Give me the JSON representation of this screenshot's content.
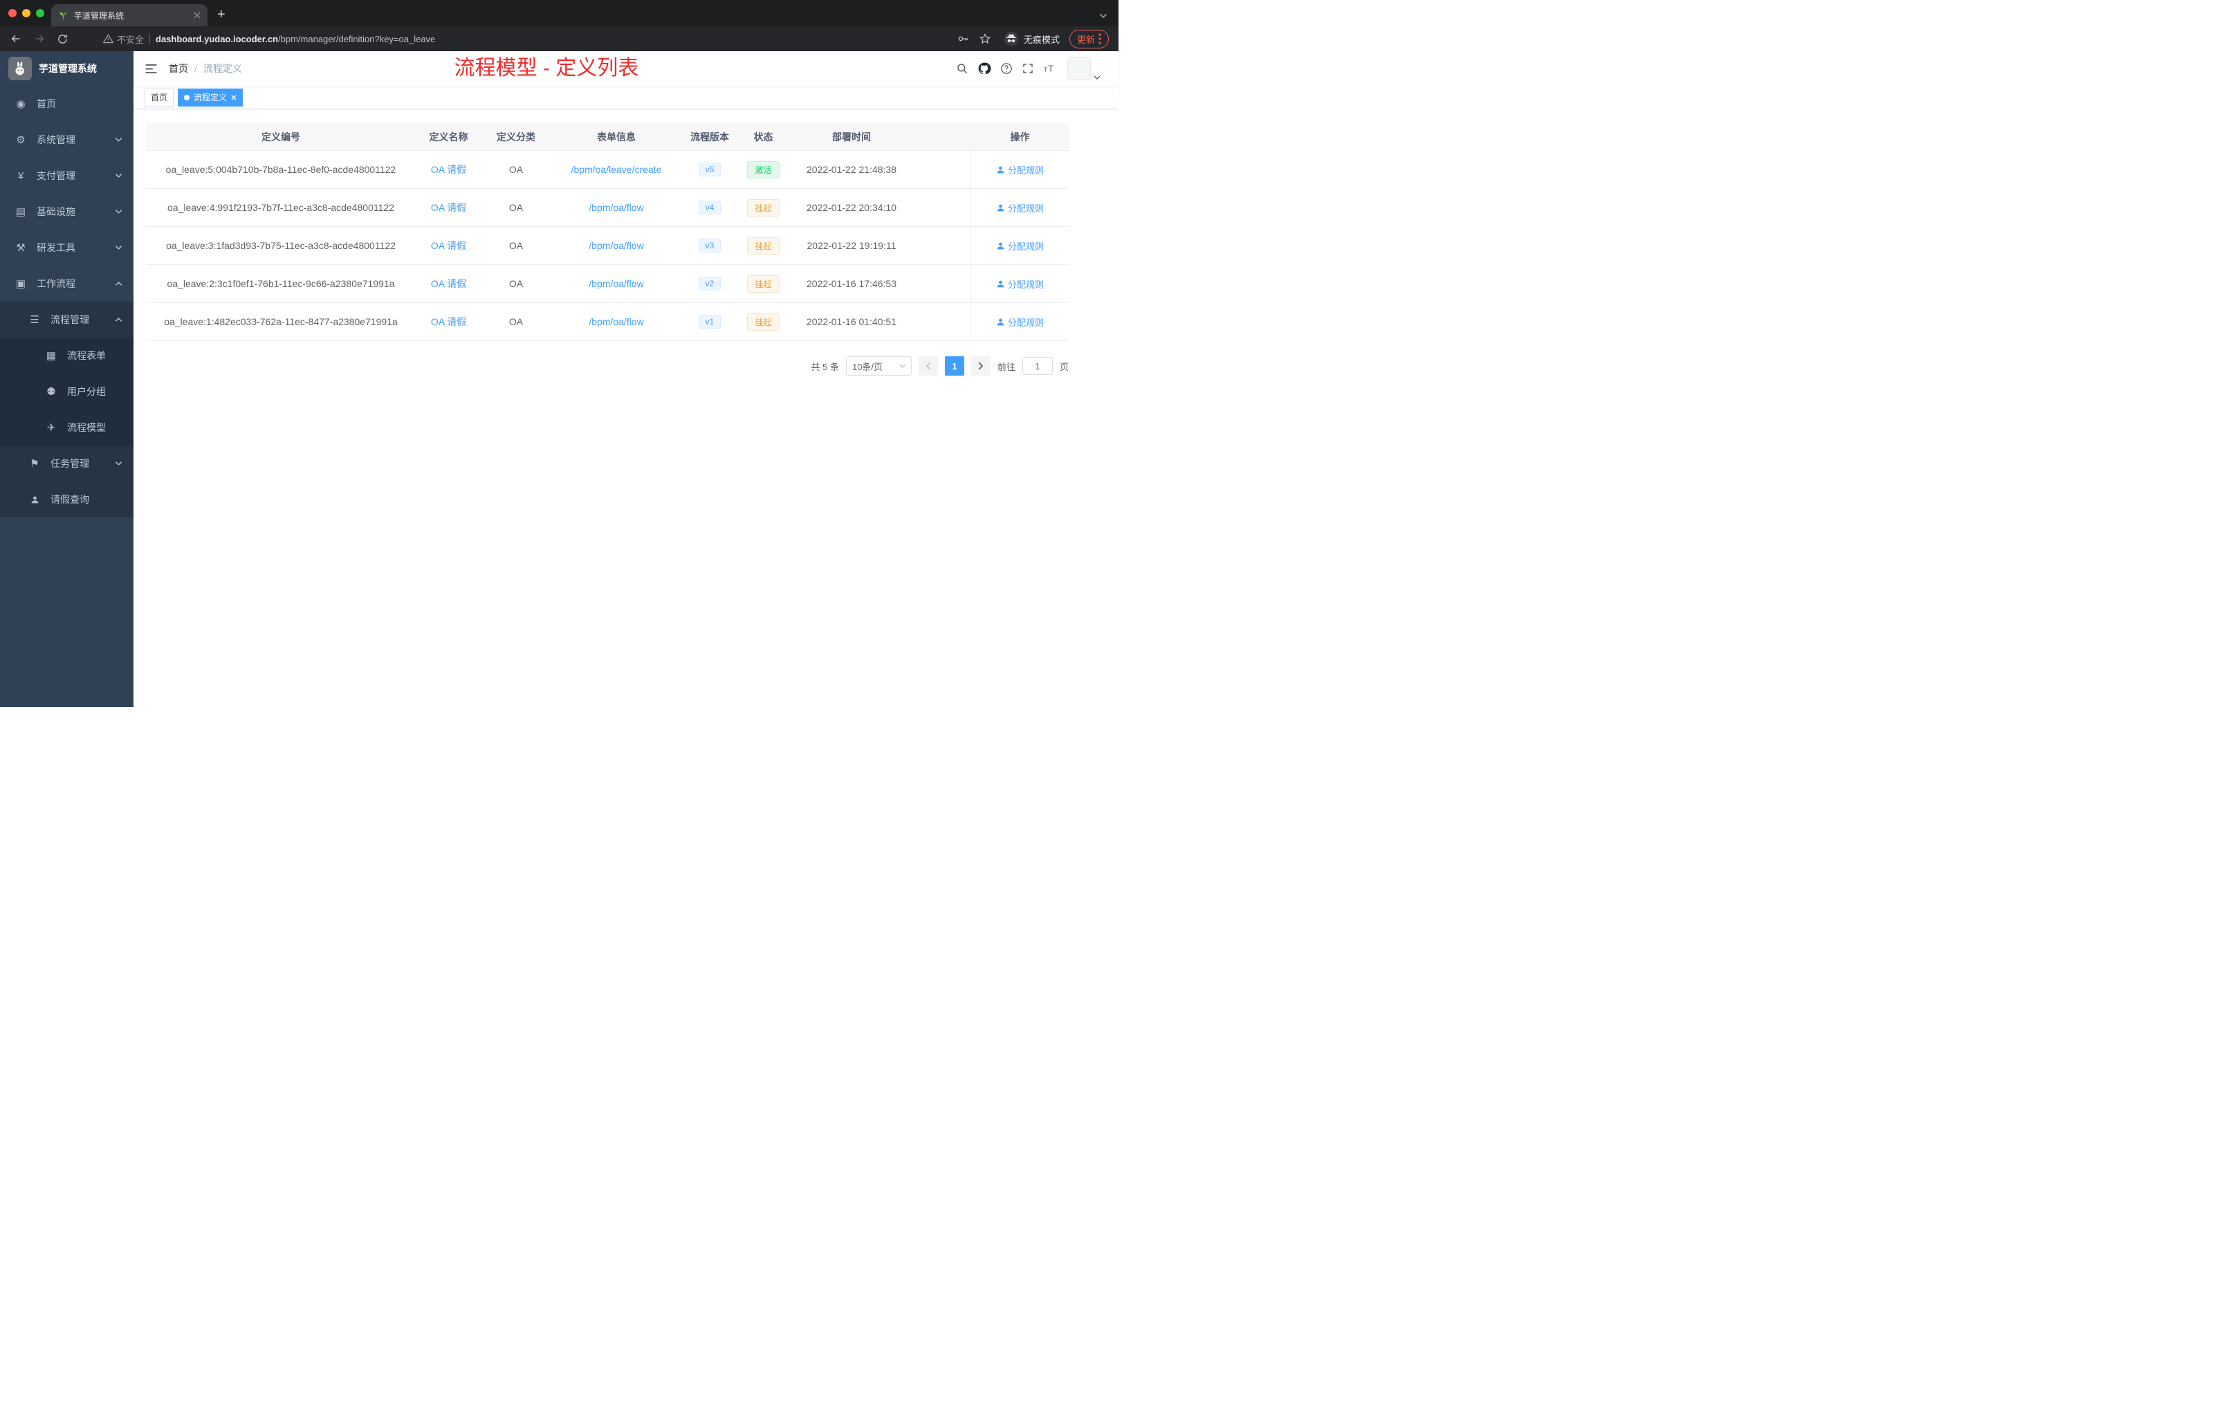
{
  "theme": {
    "accent": "#409eff",
    "annotation_red": "#f42a2a",
    "success": "#13ce66",
    "warning": "#e6a23c",
    "sidebar_bg": "#304156"
  },
  "browser": {
    "tab_title": "芋道管理系统",
    "security_label": "不安全",
    "url_domain": "dashboard.yudao.iocoder.cn",
    "url_path": "/bpm/manager/definition?key=oa_leave",
    "incognito_label": "无痕模式",
    "update_label": "更新"
  },
  "sidebar": {
    "logo_title": "芋道管理系统",
    "items": [
      {
        "label": "首页",
        "icon": "dashboard-icon",
        "level": 1
      },
      {
        "label": "系统管理",
        "icon": "gear-icon",
        "level": 1,
        "arrow": "down"
      },
      {
        "label": "支付管理",
        "icon": "yen-icon",
        "level": 1,
        "arrow": "down"
      },
      {
        "label": "基础设施",
        "icon": "infra-icon",
        "level": 1,
        "arrow": "down"
      },
      {
        "label": "研发工具",
        "icon": "tools-icon",
        "level": 1,
        "arrow": "down"
      },
      {
        "label": "工作流程",
        "icon": "workflow-icon",
        "level": 1,
        "arrow": "up"
      },
      {
        "label": "流程管理",
        "icon": "process-manage-icon",
        "level": 2,
        "arrow": "up"
      },
      {
        "label": "流程表单",
        "icon": "form-icon",
        "level": 3
      },
      {
        "label": "用户分组",
        "icon": "user-group-icon",
        "level": 3
      },
      {
        "label": "流程模型",
        "icon": "model-icon",
        "level": 3
      },
      {
        "label": "任务管理",
        "icon": "task-icon",
        "level": 2,
        "arrow": "down"
      },
      {
        "label": "请假查询",
        "icon": "person-icon",
        "level": 2
      }
    ]
  },
  "header": {
    "breadcrumb_home": "首页",
    "breadcrumb_separator": "/",
    "breadcrumb_current": "流程定义",
    "annotation": "流程模型 - 定义列表"
  },
  "tags": [
    {
      "label": "首页",
      "active": false
    },
    {
      "label": "流程定义",
      "active": true
    }
  ],
  "table": {
    "columns": [
      "定义编号",
      "定义名称",
      "定义分类",
      "表单信息",
      "流程版本",
      "状态",
      "部署时间",
      "操作"
    ],
    "rows": [
      {
        "id": "oa_leave:5:004b710b-7b8a-11ec-8ef0-acde48001122",
        "name": "OA 请假",
        "category": "OA",
        "form": "/bpm/oa/leave/create",
        "version": "v5",
        "status": "激活",
        "status_type": "success",
        "deploy_time": "2022-01-22 21:48:38",
        "action": "分配规则"
      },
      {
        "id": "oa_leave:4:991f2193-7b7f-11ec-a3c8-acde48001122",
        "name": "OA 请假",
        "category": "OA",
        "form": "/bpm/oa/flow",
        "version": "v4",
        "status": "挂起",
        "status_type": "warning",
        "deploy_time": "2022-01-22 20:34:10",
        "action": "分配规则"
      },
      {
        "id": "oa_leave:3:1fad3d93-7b75-11ec-a3c8-acde48001122",
        "name": "OA 请假",
        "category": "OA",
        "form": "/bpm/oa/flow",
        "version": "v3",
        "status": "挂起",
        "status_type": "warning",
        "deploy_time": "2022-01-22 19:19:11",
        "action": "分配规则"
      },
      {
        "id": "oa_leave:2:3c1f0ef1-76b1-11ec-9c66-a2380e71991a",
        "name": "OA 请假",
        "category": "OA",
        "form": "/bpm/oa/flow",
        "version": "v2",
        "status": "挂起",
        "status_type": "warning",
        "deploy_time": "2022-01-16 17:46:53",
        "action": "分配规则"
      },
      {
        "id": "oa_leave:1:482ec033-762a-11ec-8477-a2380e71991a",
        "name": "OA 请假",
        "category": "OA",
        "form": "/bpm/oa/flow",
        "version": "v1",
        "status": "挂起",
        "status_type": "warning",
        "deploy_time": "2022-01-16 01:40:51",
        "action": "分配规则"
      }
    ]
  },
  "pagination": {
    "total": "共 5 条",
    "page_size": "10条/页",
    "current": "1",
    "goto_label": "前往",
    "goto_value": "1",
    "unit_label": "页"
  }
}
